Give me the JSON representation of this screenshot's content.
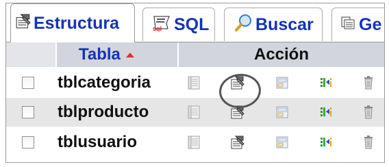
{
  "tabs": [
    {
      "id": "estructura",
      "label": "Estructura",
      "icon": "structure-icon",
      "active": true
    },
    {
      "id": "sql",
      "label": "SQL",
      "icon": "sql-icon",
      "active": false
    },
    {
      "id": "buscar",
      "label": "Buscar",
      "icon": "search-icon",
      "active": false
    },
    {
      "id": "generar",
      "label": "Ge",
      "icon": "query-icon",
      "active": false
    }
  ],
  "table": {
    "columns": {
      "name": "Tabla",
      "actions": "Acción"
    },
    "sort": {
      "column": "Tabla",
      "direction": "ascending",
      "indicator_color": "#e03030"
    },
    "rows": [
      {
        "name": "tblcategoria",
        "checked": false
      },
      {
        "name": "tblproducto",
        "checked": false
      },
      {
        "name": "tblusuario",
        "checked": false
      }
    ],
    "actions": [
      "browse-icon",
      "structure-icon",
      "search-icon",
      "insert-icon",
      "drop-icon"
    ],
    "highlighted_action": {
      "row": 0,
      "action": "structure-icon"
    }
  },
  "colors": {
    "link_blue": "#1533b5",
    "header_bg": "#d2d5de",
    "even_row_bg": "#e6e6e6"
  }
}
